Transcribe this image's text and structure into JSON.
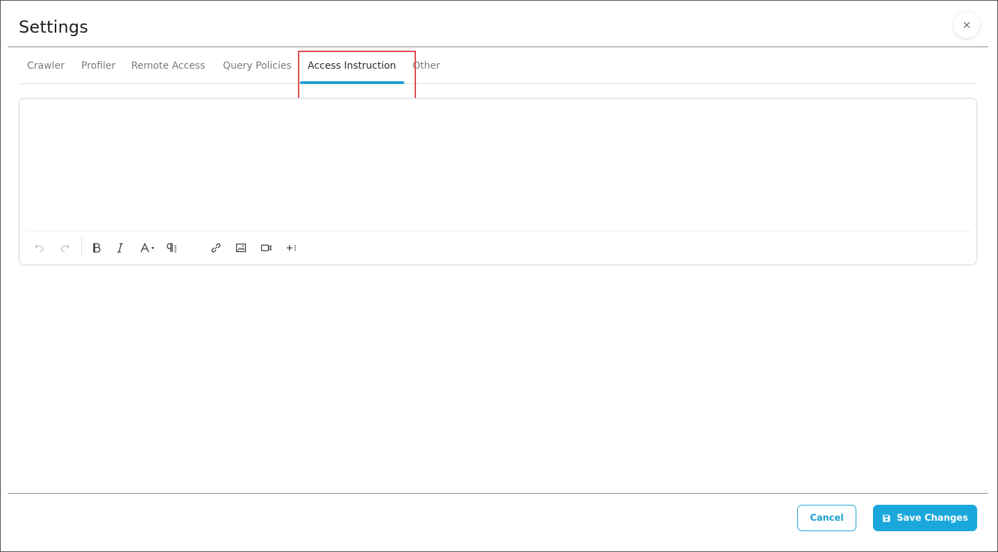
{
  "dialog": {
    "title": "Settings"
  },
  "tabs": [
    {
      "label": "Crawler",
      "active": false
    },
    {
      "label": "Profiler",
      "active": false
    },
    {
      "label": "Remote Access",
      "active": false
    },
    {
      "label": "Query Policies",
      "active": false
    },
    {
      "label": "Access Instruction",
      "active": true
    },
    {
      "label": "Other",
      "active": false
    }
  ],
  "editor": {
    "content": "",
    "toolbar": [
      "undo-icon",
      "redo-icon",
      "bold-icon",
      "italic-icon",
      "font-color-icon",
      "paragraph-format-icon",
      "link-icon",
      "image-icon",
      "video-icon",
      "more-icon"
    ]
  },
  "footer": {
    "cancel_label": "Cancel",
    "save_label": "Save Changes"
  },
  "colors": {
    "accent": "#1aa8dc",
    "highlight": "#e0474c"
  }
}
